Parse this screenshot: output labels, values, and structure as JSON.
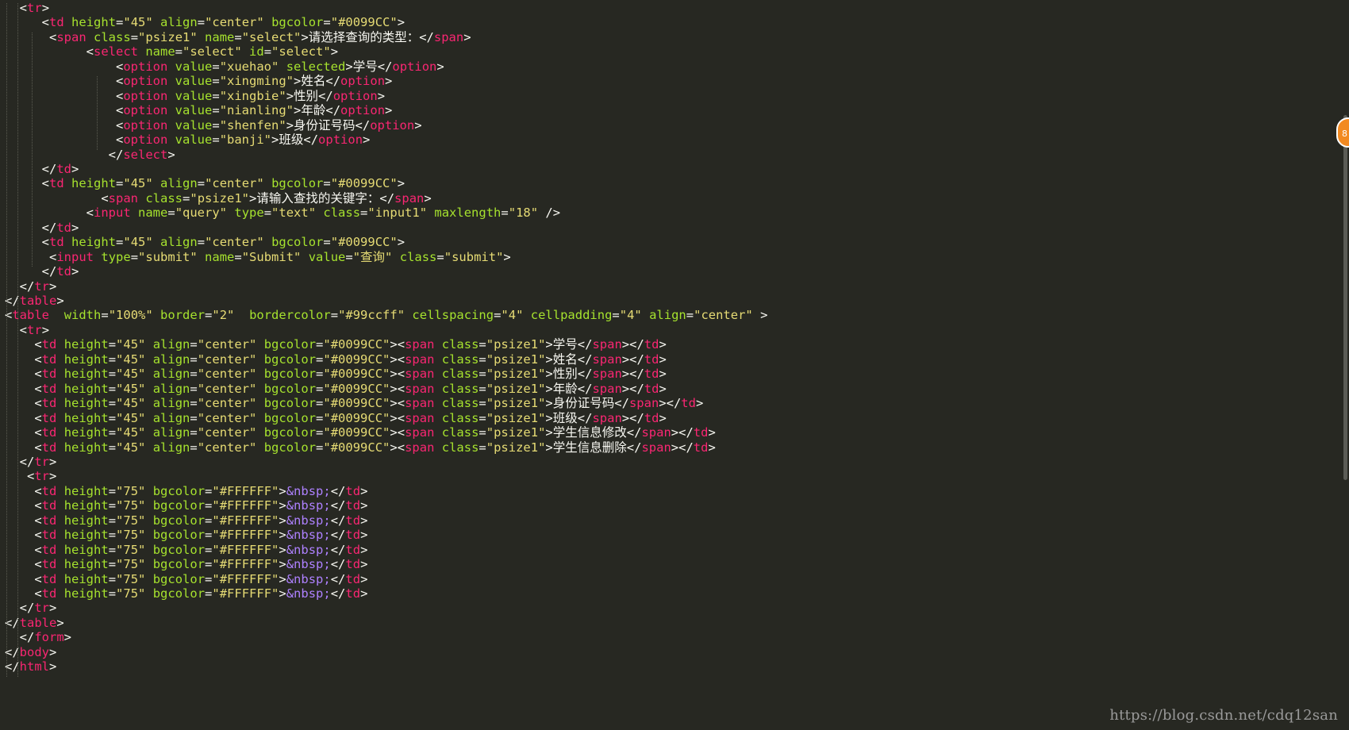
{
  "code_lines": [
    "  <tr>",
    "     <td height=\"45\" align=\"center\" bgcolor=\"#0099CC\">",
    "      <span class=\"psize1\" name=\"select\">请选择查询的类型：</span>",
    "           <select name=\"select\" id=\"select\">",
    "               <option value=\"xuehao\" selected>学号</option>",
    "               <option value=\"xingming\">姓名</option>",
    "               <option value=\"xingbie\">性别</option>",
    "               <option value=\"nianling\">年龄</option>",
    "               <option value=\"shenfen\">身份证号码</option>",
    "               <option value=\"banji\">班级</option>",
    "              </select>",
    "     </td>",
    "     <td height=\"45\" align=\"center\" bgcolor=\"#0099CC\">",
    "             <span class=\"psize1\">请输入查找的关键字：</span>",
    "           <input name=\"query\" type=\"text\" class=\"input1\" maxlength=\"18\" />",
    "     </td>",
    "     <td height=\"45\" align=\"center\" bgcolor=\"#0099CC\">",
    "      <input type=\"submit\" name=\"Submit\" value=\"查询\" class=\"submit\">",
    "     </td>",
    "  </tr>",
    "</table>",
    "<table  width=\"100%\" border=\"2\"  bordercolor=\"#99ccff\" cellspacing=\"4\" cellpadding=\"4\" align=\"center\" >",
    "  <tr>",
    "    <td height=\"45\" align=\"center\" bgcolor=\"#0099CC\"><span class=\"psize1\">学号</span></td>",
    "    <td height=\"45\" align=\"center\" bgcolor=\"#0099CC\"><span class=\"psize1\">姓名</span></td>",
    "    <td height=\"45\" align=\"center\" bgcolor=\"#0099CC\"><span class=\"psize1\">性别</span></td>",
    "    <td height=\"45\" align=\"center\" bgcolor=\"#0099CC\"><span class=\"psize1\">年龄</span></td>",
    "    <td height=\"45\" align=\"center\" bgcolor=\"#0099CC\"><span class=\"psize1\">身份证号码</span></td>",
    "    <td height=\"45\" align=\"center\" bgcolor=\"#0099CC\"><span class=\"psize1\">班级</span></td>",
    "    <td height=\"45\" align=\"center\" bgcolor=\"#0099CC\"><span class=\"psize1\">学生信息修改</span></td>",
    "    <td height=\"45\" align=\"center\" bgcolor=\"#0099CC\"><span class=\"psize1\">学生信息删除</span></td>",
    "  </tr>",
    "   <tr>",
    "    <td height=\"75\" bgcolor=\"#FFFFFF\">&nbsp;</td>",
    "    <td height=\"75\" bgcolor=\"#FFFFFF\">&nbsp;</td>",
    "    <td height=\"75\" bgcolor=\"#FFFFFF\">&nbsp;</td>",
    "    <td height=\"75\" bgcolor=\"#FFFFFF\">&nbsp;</td>",
    "    <td height=\"75\" bgcolor=\"#FFFFFF\">&nbsp;</td>",
    "    <td height=\"75\" bgcolor=\"#FFFFFF\">&nbsp;</td>",
    "    <td height=\"75\" bgcolor=\"#FFFFFF\">&nbsp;</td>",
    "    <td height=\"75\" bgcolor=\"#FFFFFF\">&nbsp;</td>",
    "  </tr>",
    "</table>",
    "  </form>",
    "</body>",
    "</html>"
  ],
  "badge_text": "8",
  "watermark": "https://blog.csdn.net/cdq12san",
  "colors": {
    "background": "#272822",
    "tag": "#f92672",
    "attribute": "#a6e22e",
    "string": "#e6db74",
    "entity": "#ae81ff",
    "text": "#f8f8f2",
    "badge": "#f28a22"
  }
}
